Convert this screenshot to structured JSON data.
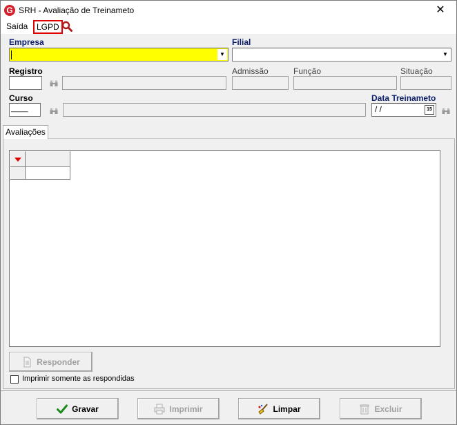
{
  "window": {
    "title": "SRH - Avaliação de Treinameto",
    "app_icon_letter": "G",
    "close_glyph": "✕"
  },
  "menu": {
    "items": [
      "Saída",
      "LGPD"
    ],
    "search_icon": "magnifier-icon"
  },
  "form": {
    "empresa_label": "Empresa",
    "filial_label": "Filial",
    "registro_label": "Registro",
    "admissao_label": "Admissão",
    "funcao_label": "Função",
    "situacao_label": "Situação",
    "curso_label": "Curso",
    "data_label": "Data Treinameto",
    "empresa_value": "",
    "filial_value": "",
    "registro_value": "",
    "curso_value": "____",
    "data_value": " / /",
    "calendar_day": "15"
  },
  "tabs": [
    "Avaliações"
  ],
  "panel": {
    "responder_label": "Responder",
    "checkbox_label": "Imprimir somente as respondidas"
  },
  "buttons": {
    "gravar": "Gravar",
    "imprimir": "Imprimir",
    "limpar": "Limpar",
    "excluir": "Excluir"
  },
  "colors": {
    "required_field": "#ffff00",
    "label_accent": "#0b1d6b",
    "highlight_border": "#e00000"
  }
}
